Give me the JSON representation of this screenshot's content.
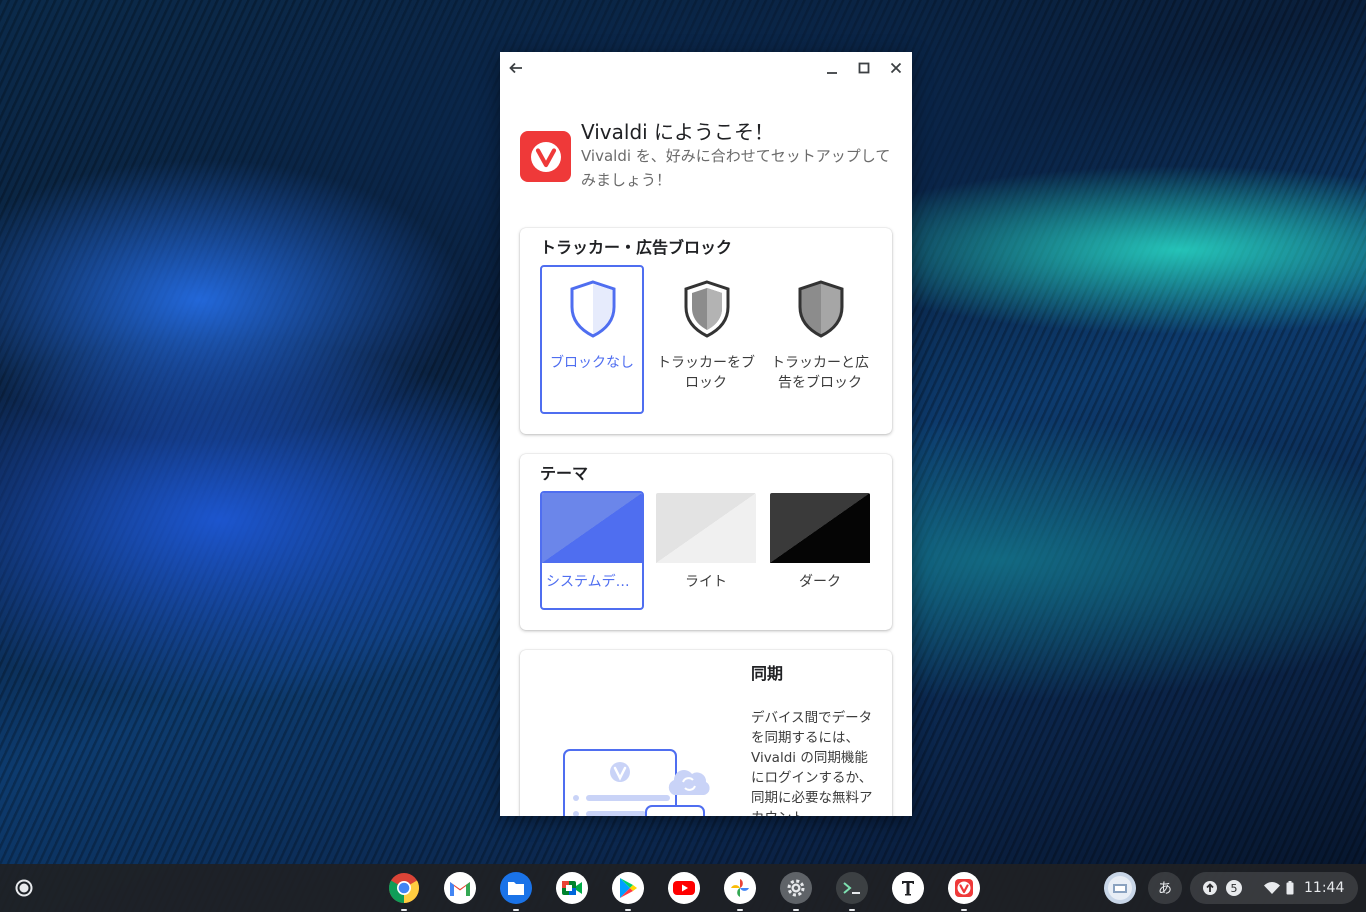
{
  "window": {
    "header": {
      "title": "Vivaldi にようこそ！",
      "subtitle": "Vivaldi を、好みに合わせてセットアップしてみましょう！"
    },
    "tracker_card": {
      "title": "トラッカー・広告ブロック",
      "options": [
        {
          "label": "ブロックなし",
          "selected": true
        },
        {
          "label": "トラッカーをブロック",
          "selected": false
        },
        {
          "label": "トラッカーと広告をブロック",
          "selected": false
        }
      ]
    },
    "theme_card": {
      "title": "テーマ",
      "options": [
        {
          "label": "システムデフ…",
          "selected": true
        },
        {
          "label": "ライト",
          "selected": false
        },
        {
          "label": "ダーク",
          "selected": false
        }
      ]
    },
    "sync_card": {
      "title": "同期",
      "description": "デバイス間でデータを同期するには、Vivaldi の同期機能にログインするか、同期に必要な無料アカウント"
    }
  },
  "shelf": {
    "apps": [
      "chrome",
      "gmail",
      "files",
      "meet",
      "play-store",
      "youtube",
      "photos",
      "settings",
      "terminal",
      "text",
      "vivaldi"
    ],
    "ime": "あ",
    "notification_count": "5",
    "time": "11:44"
  },
  "colors": {
    "accent": "#4f6ef0",
    "vivaldi_red": "#ef3939"
  }
}
